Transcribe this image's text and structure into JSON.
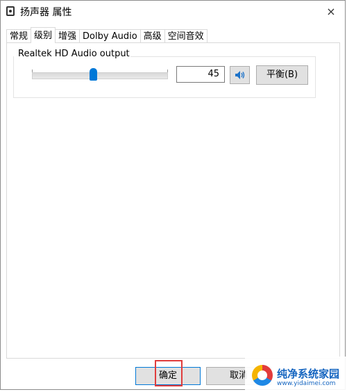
{
  "window": {
    "title": "扬声器 属性",
    "close_icon": "×"
  },
  "tabs": [
    {
      "label": "常规"
    },
    {
      "label": "级别",
      "active": true
    },
    {
      "label": "增强"
    },
    {
      "label": "Dolby Audio"
    },
    {
      "label": "高级"
    },
    {
      "label": "空间音效"
    }
  ],
  "levels": {
    "device_name": "Realtek HD Audio output",
    "volume_value": "45",
    "volume_fraction": 0.45,
    "mute_icon": "speaker-icon",
    "balance_label": "平衡(B)"
  },
  "footer": {
    "ok_label": "确定",
    "cancel_label": "取消"
  },
  "watermark": {
    "title": "纯净系统家园",
    "url": "www.yidaimei.com"
  },
  "colors": {
    "accent": "#0078d7",
    "highlight": "#e03c3c"
  }
}
